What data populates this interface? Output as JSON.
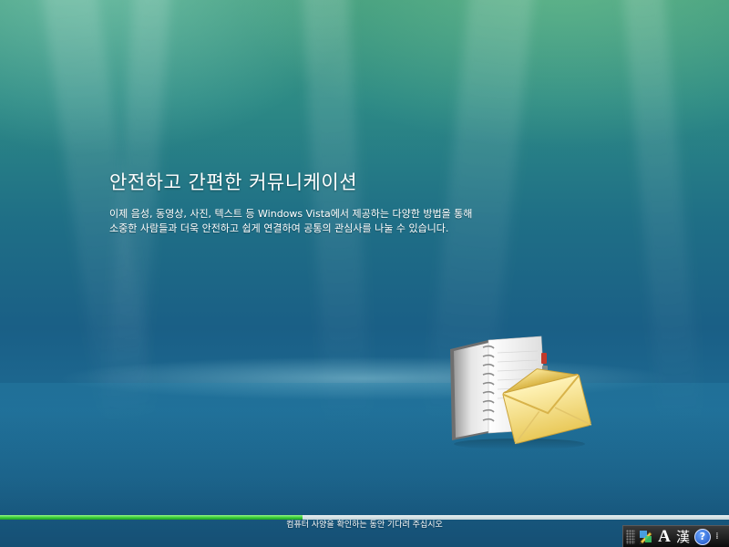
{
  "slide": {
    "heading": "안전하고 간편한 커뮤니케이션",
    "body": "이제 음성, 동영상, 사진, 텍스트 등 Windows Vista에서 제공하는 다양한 방법을 통해 소중한 사람들과 더욱 안전하고 쉽게 연결하여 공통의 관심사를 나눌 수 있습니다."
  },
  "illustration": {
    "icon": "notebook-envelope-icon"
  },
  "progress": {
    "fraction": 0.415,
    "status_text": "컴퓨터 사양을 확인하는 동안 기다려 주십시오"
  },
  "language_bar": {
    "input_mode_label": "A",
    "hanja_label": "漢",
    "help_label": "?",
    "options_label": "⁞",
    "icons": [
      "grip-icon",
      "ime-pad-icon",
      "help-icon",
      "options-arrow-icon"
    ]
  },
  "colors": {
    "background_top": "#3f9a7c",
    "background_mid": "#1f6f86",
    "background_bottom": "#154f74",
    "progress_fill": "#3fd23b",
    "text": "#ffffff"
  }
}
